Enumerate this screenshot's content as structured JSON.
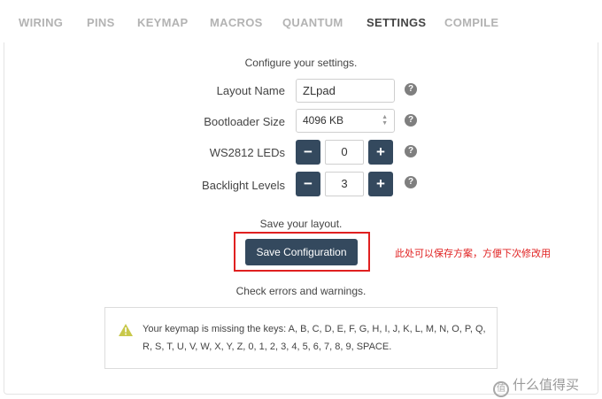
{
  "tabs": [
    "WIRING",
    "PINS",
    "KEYMAP",
    "MACROS",
    "QUANTUM",
    "SETTINGS",
    "COMPILE"
  ],
  "active_tab": "SETTINGS",
  "settings": {
    "intro": "Configure your settings.",
    "layout_name_label": "Layout Name",
    "layout_name_value": "ZLpad",
    "bootloader_label": "Bootloader Size",
    "bootloader_value": "4096 KB",
    "ws2812_label": "WS2812 LEDs",
    "ws2812_value": "0",
    "backlight_label": "Backlight Levels",
    "backlight_value": "3",
    "help_glyph": "?",
    "minus_glyph": "−",
    "plus_glyph": "+"
  },
  "save": {
    "prompt": "Save your layout.",
    "button_label": "Save Configuration",
    "annotation": "此处可以保存方案，方便下次修改用"
  },
  "check": {
    "prompt": "Check errors and warnings.",
    "warning": "Your keymap is missing the keys: A, B, C, D, E, F, G, H, I, J, K, L, M, N, O, P, Q, R, S, T, U, V, W, X, Y, Z, 0, 1, 2, 3, 4, 5, 6, 7, 8, 9, SPACE."
  },
  "watermark": {
    "logo_text": "值",
    "text": "什么值得买"
  },
  "colors": {
    "accent": "#34495e",
    "annotation": "#e02020",
    "warning_icon": "#c8c84a"
  }
}
